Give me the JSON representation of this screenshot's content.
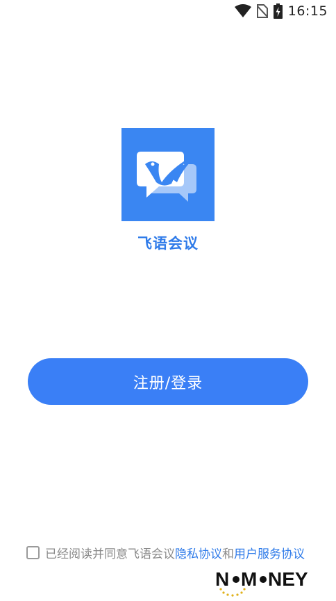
{
  "status_bar": {
    "time": "16:15",
    "icons": [
      "wifi-icon",
      "no-sim-icon",
      "battery-charging-icon"
    ]
  },
  "app": {
    "logo_icon": "bird-chat-bubble-logo",
    "name": "飞语会议",
    "brand_color": "#3a86f2"
  },
  "actions": {
    "register_login_label": "注册/登录"
  },
  "agreement": {
    "checked": false,
    "prefix": "已经阅读并同意飞语会议",
    "privacy_link": "隐私协议",
    "conjunction": "和",
    "service_link": "用户服务协议"
  },
  "watermark": {
    "text": "NOMONEY"
  }
}
